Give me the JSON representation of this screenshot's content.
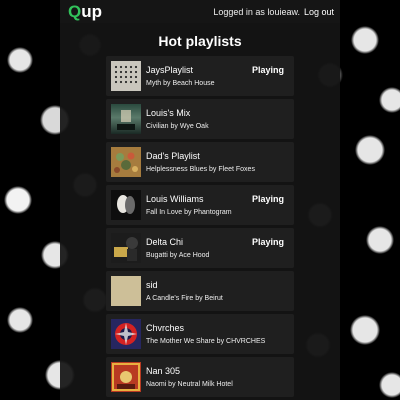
{
  "brand": {
    "q": "Q",
    "rest": "up"
  },
  "nav": {
    "logged_in": "Logged in as louieaw.",
    "logout": "Log out"
  },
  "heading": "Hot playlists",
  "colors": {
    "brand_green": "#32c25b"
  },
  "playlists": [
    {
      "name": "JaysPlaylist",
      "subtitle": "Myth by Beach House",
      "status": "Playing",
      "art": "beach-house-art"
    },
    {
      "name": "Louis's Mix",
      "subtitle": "Civilian by Wye Oak",
      "status": "",
      "art": "wye-oak-art"
    },
    {
      "name": "Dad's Playlist",
      "subtitle": "Helplessness Blues by Fleet Foxes",
      "status": "",
      "art": "fleet-foxes-art"
    },
    {
      "name": "Louis Williams",
      "subtitle": "Fall In Love by Phantogram",
      "status": "Playing",
      "art": "phantogram-art"
    },
    {
      "name": "Delta Chi",
      "subtitle": "Bugatti by Ace Hood",
      "status": "Playing",
      "art": "ace-hood-art"
    },
    {
      "name": "sid",
      "subtitle": "A Candle's Fire by Beirut",
      "status": "",
      "art": "beirut-art"
    },
    {
      "name": "Chvrches",
      "subtitle": "The Mother We Share by CHVRCHES",
      "status": "",
      "art": "chvrches-art"
    },
    {
      "name": "Nan 305",
      "subtitle": "Naomi by Neutral Milk Hotel",
      "status": "",
      "art": "neutral-milk-hotel-art"
    }
  ]
}
